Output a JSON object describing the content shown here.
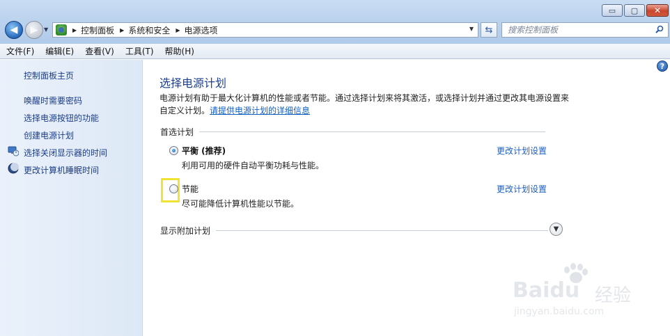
{
  "window": {
    "buttons": {
      "minimize": "▭",
      "maximize": "▢",
      "close": "✕"
    }
  },
  "nav": {
    "back_glyph": "◀",
    "forward_glyph": "▶",
    "breadcrumbs": [
      "控制面板",
      "系统和安全",
      "电源选项"
    ],
    "search_placeholder": "搜索控制面板"
  },
  "menu": [
    "文件(F)",
    "编辑(E)",
    "查看(V)",
    "工具(T)",
    "帮助(H)"
  ],
  "sidebar": {
    "home": "控制面板主页",
    "links": [
      "唤醒时需要密码",
      "选择电源按钮的功能",
      "创建电源计划",
      "选择关闭显示器的时间",
      "更改计算机睡眠时间"
    ]
  },
  "main": {
    "title": "选择电源计划",
    "description": "电源计划有助于最大化计算机的性能或者节能。通过选择计划来将其激活，或选择计划并通过更改其电源设置来自定义计划。",
    "description_link": "请提供电源计划的详细信息",
    "preferred_group": "首选计划",
    "plans": [
      {
        "name": "平衡 (推荐)",
        "description": "利用可用的硬件自动平衡功耗与性能。",
        "link": "更改计划设置",
        "selected": true
      },
      {
        "name": "节能",
        "description": "尽可能降低计算机性能以节能。",
        "link": "更改计划设置",
        "selected": false
      }
    ],
    "additional_group": "显示附加计划",
    "help_glyph": "?"
  },
  "watermark": {
    "brand": "Baidu",
    "brand_cn": "经验",
    "url": "jingyan.baidu.com"
  }
}
